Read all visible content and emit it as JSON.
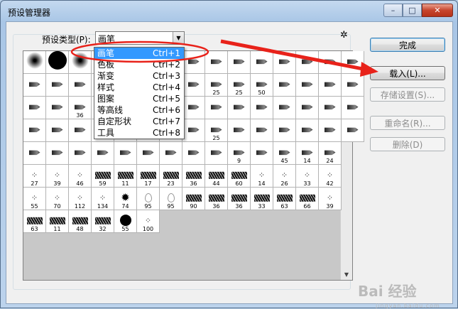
{
  "window": {
    "title": "预设管理器",
    "min_glyph": "–",
    "max_glyph": "□",
    "close_glyph": "✕"
  },
  "preset": {
    "label": "预设类型(P):",
    "value": "画笔",
    "options": [
      {
        "label": "画笔",
        "shortcut": "Ctrl+1"
      },
      {
        "label": "色板",
        "shortcut": "Ctrl+2"
      },
      {
        "label": "渐变",
        "shortcut": "Ctrl+3"
      },
      {
        "label": "样式",
        "shortcut": "Ctrl+4"
      },
      {
        "label": "图案",
        "shortcut": "Ctrl+5"
      },
      {
        "label": "等高线",
        "shortcut": "Ctrl+6"
      },
      {
        "label": "自定形状",
        "shortcut": "Ctrl+7"
      },
      {
        "label": "工具",
        "shortcut": "Ctrl+8"
      }
    ]
  },
  "buttons": {
    "done": "完成",
    "load": "载入(L)...",
    "save": "存储设置(S)...",
    "rename": "重命名(R)...",
    "delete": "删除(D)"
  },
  "brush_grid": {
    "rows": [
      [
        "",
        "",
        "",
        "",
        "",
        "",
        "",
        "",
        "",
        "",
        "",
        "",
        "",
        "",
        ""
      ],
      [
        "",
        "",
        "",
        "",
        "",
        "",
        "",
        "",
        "25",
        "25",
        "50",
        "",
        "",
        "",
        ""
      ],
      [
        "",
        "",
        "36",
        "",
        "",
        "",
        "",
        "",
        "",
        "",
        "",
        "",
        "",
        "",
        ""
      ],
      [
        "",
        "",
        "",
        "",
        "",
        "",
        "",
        "",
        "25",
        "",
        "",
        "",
        "",
        "",
        ""
      ],
      [
        "",
        "",
        "",
        "",
        "",
        "",
        "",
        "",
        "",
        "9",
        "",
        "45",
        "14",
        "24"
      ],
      [
        "27",
        "39",
        "46",
        "59",
        "11",
        "17",
        "23",
        "36",
        "44",
        "60",
        "14",
        "26",
        "33",
        "42"
      ],
      [
        "55",
        "70",
        "112",
        "134",
        "74",
        "95",
        "95",
        "90",
        "36",
        "36",
        "33",
        "63",
        "66",
        "39"
      ],
      [
        "63",
        "11",
        "48",
        "32",
        "55",
        "100"
      ]
    ]
  },
  "watermark": {
    "text": "Bai 经验",
    "sub": "jingyan.baidu.com"
  },
  "colors": {
    "annotation": "#e8221a",
    "selected": "#3399ff"
  }
}
